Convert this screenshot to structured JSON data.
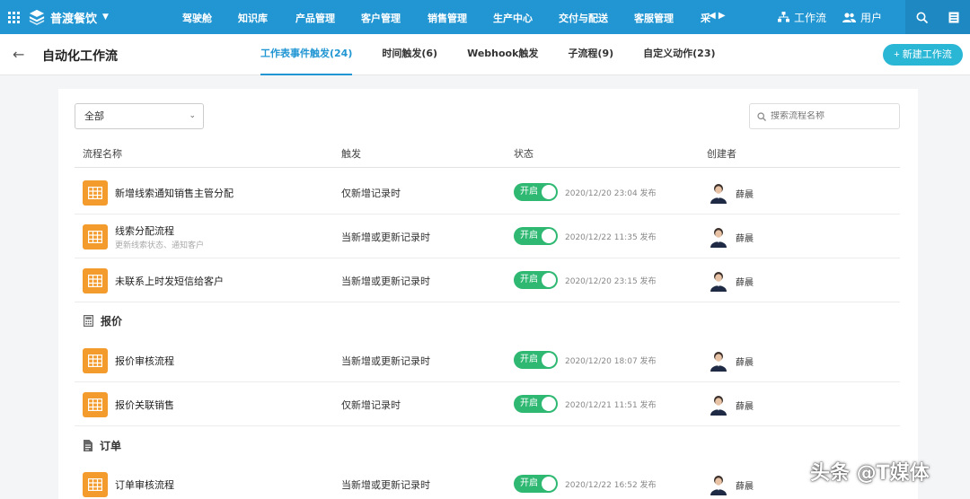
{
  "topnav": {
    "brand": "普渡餐饮",
    "items": [
      "驾驶舱",
      "知识库",
      "产品管理",
      "客户管理",
      "销售管理",
      "生产中心",
      "交付与配送",
      "客服管理",
      "采"
    ],
    "workflow_label": "工作流",
    "users_label": "用户"
  },
  "header": {
    "title": "自动化工作流",
    "tabs": [
      "工作表事件触发(24)",
      "时间触发(6)",
      "Webhook触发",
      "子流程(9)",
      "自定义动作(23)"
    ],
    "new_button": "+ 新建工作流"
  },
  "filters": {
    "select_value": "全部",
    "search_placeholder": "搜索流程名称"
  },
  "columns": [
    "流程名称",
    "触发",
    "状态",
    "创建者"
  ],
  "toggle_label": "开启",
  "groups": [
    "报价",
    "订单"
  ],
  "rows": [
    {
      "name": "新增线索通知销售主管分配",
      "sub": "",
      "trigger": "仅新增记录时",
      "time": "2020/12/20 23:04 发布",
      "creator": "薛晨"
    },
    {
      "name": "线索分配流程",
      "sub": "更新线索状态、通知客户",
      "trigger": "当新增或更新记录时",
      "time": "2020/12/22 11:35 发布",
      "creator": "薛晨"
    },
    {
      "name": "未联系上时发短信给客户",
      "sub": "",
      "trigger": "当新增或更新记录时",
      "time": "2020/12/20 23:15 发布",
      "creator": "薛晨"
    },
    {
      "name": "报价审核流程",
      "sub": "",
      "trigger": "当新增或更新记录时",
      "time": "2020/12/20 18:07 发布",
      "creator": "薛晨"
    },
    {
      "name": "报价关联销售",
      "sub": "",
      "trigger": "仅新增记录时",
      "time": "2020/12/21 11:51 发布",
      "creator": "薛晨"
    },
    {
      "name": "订单审核流程",
      "sub": "",
      "trigger": "当新增或更新记录时",
      "time": "2020/12/22 16:52 发布",
      "creator": "薛晨"
    }
  ],
  "watermark": "头条 @T媒体",
  "colors": {
    "primary": "#2196d3",
    "accent": "#2ab7d6",
    "toggle_on": "#2eb872",
    "row_icon": "#f49b2d"
  }
}
